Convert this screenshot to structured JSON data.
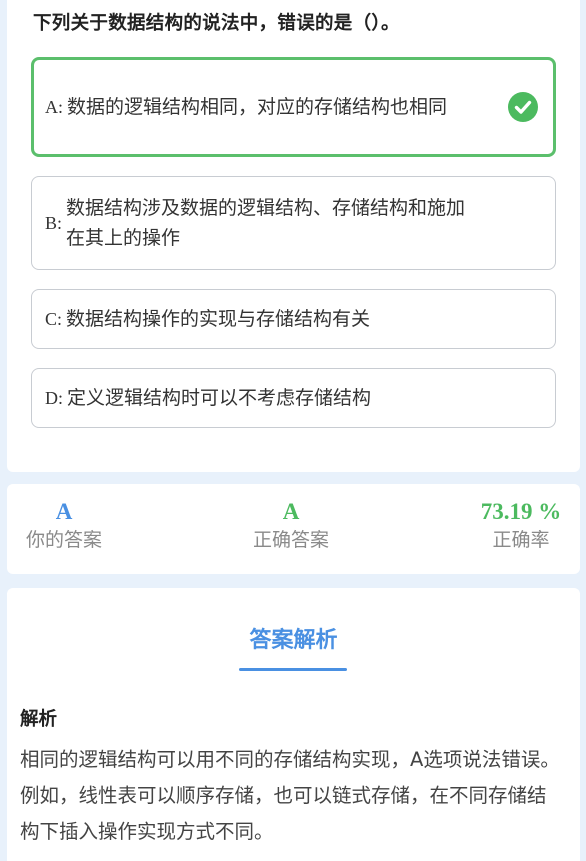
{
  "question": {
    "text": "下列关于数据结构的说法中，错误的是（）。",
    "options": [
      {
        "letter": "A:",
        "text": "数据的逻辑结构相同，对应的存储结构也相同",
        "correct": true
      },
      {
        "letter": "B:",
        "text": "数据结构涉及数据的逻辑结构、存储结构和施加在其上的操作",
        "correct": false
      },
      {
        "letter": "C:",
        "text": "数据结构操作的实现与存储结构有关",
        "correct": false
      },
      {
        "letter": "D:",
        "text": "定义逻辑结构时可以不考虑存储结构",
        "correct": false
      }
    ],
    "correct_icon": "check-circle-icon"
  },
  "stats": {
    "your_answer": {
      "value": "A",
      "label": "你的答案"
    },
    "correct_answer": {
      "value": "A",
      "label": "正确答案"
    },
    "accuracy": {
      "value": "73.19 %",
      "label": "正确率"
    }
  },
  "analysis": {
    "title": "答案解析",
    "heading": "解析",
    "body": "相同的逻辑结构可以用不同的存储结构实现，A选项说法错误。例如，线性表可以顺序存储，也可以链式存储，在不同存储结构下插入操作实现方式不同。"
  },
  "colors": {
    "accent_blue": "#4a90e2",
    "correct_green": "#4cba5f",
    "background": "#e8f1fb"
  }
}
